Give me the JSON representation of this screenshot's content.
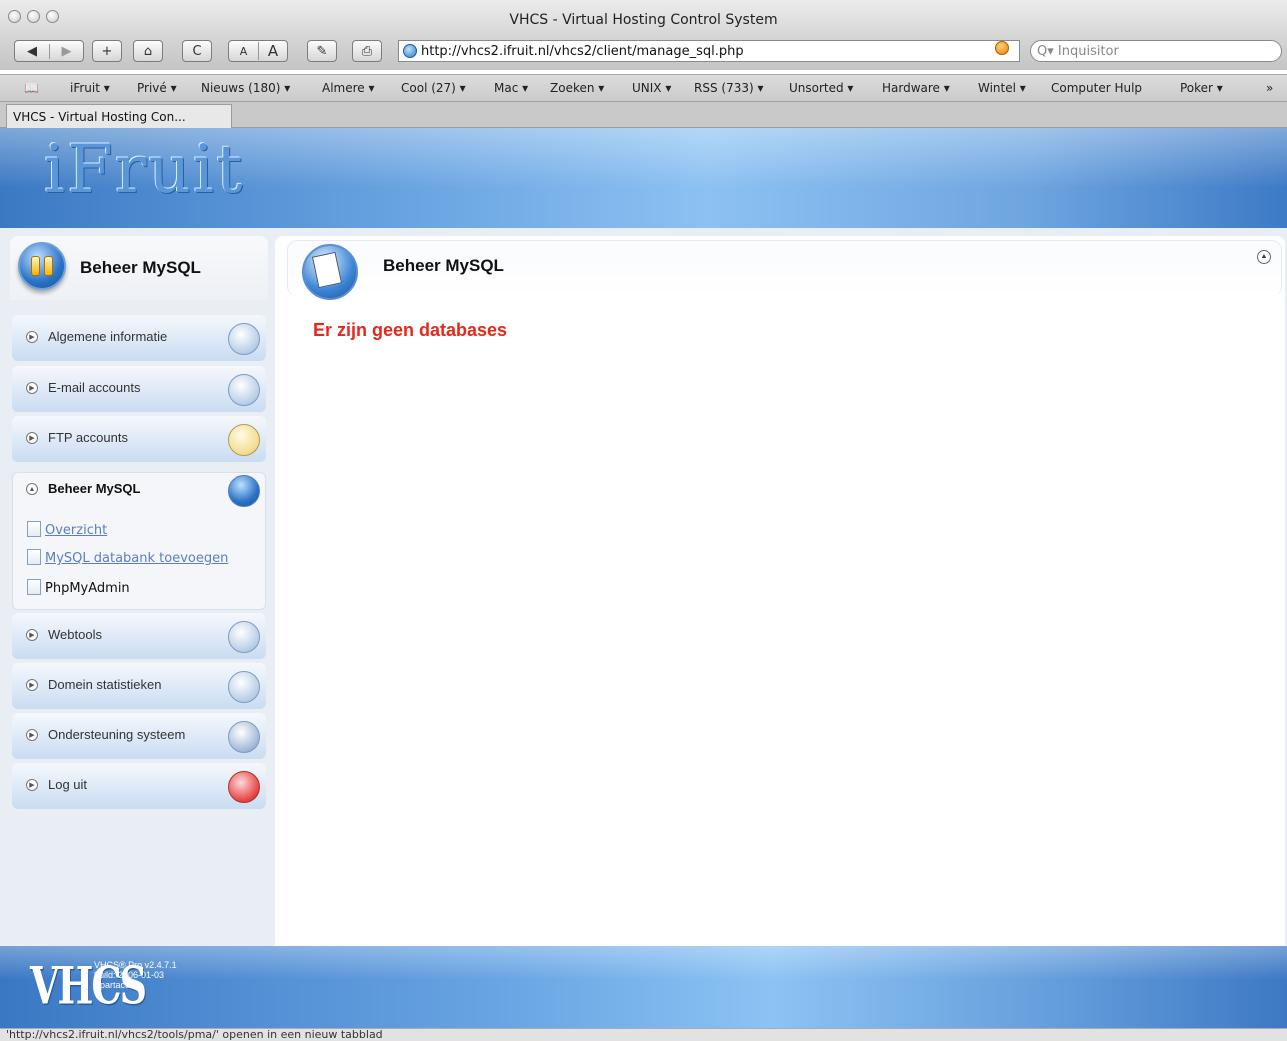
{
  "window": {
    "title": "VHCS - Virtual Hosting Control System"
  },
  "toolbar": {
    "back": "◀",
    "forward": "▶",
    "add": "+",
    "home": "⌂",
    "reload": "C",
    "text_small": "A",
    "text_large": "A",
    "edit": "✎",
    "print": "⎙",
    "url": "http://vhcs2.ifruit.nl/vhcs2/client/manage_sql.php",
    "search_placeholder": "Q▾ Inquisitor"
  },
  "bookmarks": [
    {
      "label": "iFruit ▾"
    },
    {
      "label": "Privé ▾"
    },
    {
      "label": "Nieuws (180) ▾"
    },
    {
      "label": "Almere ▾"
    },
    {
      "label": "Cool (27) ▾"
    },
    {
      "label": "Mac ▾"
    },
    {
      "label": "Zoeken ▾"
    },
    {
      "label": "UNIX ▾"
    },
    {
      "label": "RSS (733) ▾"
    },
    {
      "label": "Unsorted ▾"
    },
    {
      "label": "Hardware ▾"
    },
    {
      "label": "Wintel ▾"
    },
    {
      "label": "Computer Hulp"
    },
    {
      "label": "Poker ▾"
    },
    {
      "label": "»"
    }
  ],
  "tab": {
    "label": "VHCS - Virtual Hosting Con..."
  },
  "header": {
    "logo": "iFruit"
  },
  "sidebar": {
    "title": "Beheer MySQL",
    "items": [
      {
        "label": "Algemene informatie",
        "icon": "monitor-icon"
      },
      {
        "label": "E-mail accounts",
        "icon": "envelope-icon"
      },
      {
        "label": "FTP accounts",
        "icon": "folder-icon"
      },
      {
        "label": "Beheer MySQL",
        "icon": "database-icon"
      },
      {
        "label": "Webtools",
        "icon": "gear-icon"
      },
      {
        "label": "Domein statistieken",
        "icon": "chart-icon"
      },
      {
        "label": "Ondersteuning systeem",
        "icon": "support-icon"
      },
      {
        "label": "Log uit",
        "icon": "power-icon"
      }
    ],
    "subitems": [
      {
        "label": "Overzicht"
      },
      {
        "label": "MySQL databank toevoegen"
      },
      {
        "label": "PhpMyAdmin"
      }
    ]
  },
  "main": {
    "title": "Beheer MySQL",
    "message": "Er zijn geen databases"
  },
  "footer": {
    "logo": "VHCS",
    "version": "VHCS® Pro v2.4.7.1",
    "build": "build: 2006-01-03",
    "codename": "Spartacus"
  },
  "status": {
    "text": "'http://vhcs2.ifruit.nl/vhcs2/tools/pma/' openen in een nieuw tabblad"
  },
  "colors": {
    "error": "#e8271a",
    "link": "#5a7fbf",
    "header_blue": "#6ea8e4"
  }
}
